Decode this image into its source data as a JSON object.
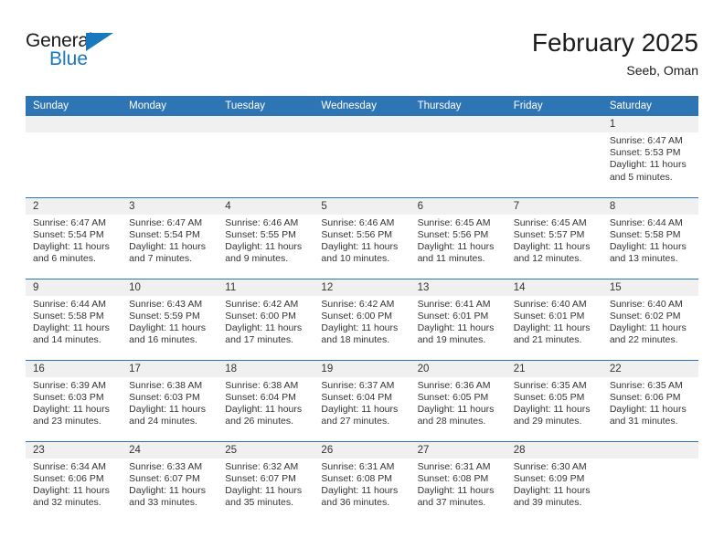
{
  "brand": {
    "name_part1": "General",
    "name_part2": "Blue",
    "logo_icon": "triangle-logo-icon"
  },
  "header": {
    "title": "February 2025",
    "subtitle": "Seeb, Oman"
  },
  "colors": {
    "header_blue": "#2e75b6",
    "brand_blue": "#1878be",
    "daynum_band": "#f0f0f0",
    "text": "#333333"
  },
  "weekday_headers": [
    "Sunday",
    "Monday",
    "Tuesday",
    "Wednesday",
    "Thursday",
    "Friday",
    "Saturday"
  ],
  "weeks": [
    [
      {
        "day": "",
        "empty": true
      },
      {
        "day": "",
        "empty": true
      },
      {
        "day": "",
        "empty": true
      },
      {
        "day": "",
        "empty": true
      },
      {
        "day": "",
        "empty": true
      },
      {
        "day": "",
        "empty": true
      },
      {
        "day": "1",
        "sunrise": "Sunrise: 6:47 AM",
        "sunset": "Sunset: 5:53 PM",
        "daylight": "Daylight: 11 hours and 5 minutes."
      }
    ],
    [
      {
        "day": "2",
        "sunrise": "Sunrise: 6:47 AM",
        "sunset": "Sunset: 5:54 PM",
        "daylight": "Daylight: 11 hours and 6 minutes."
      },
      {
        "day": "3",
        "sunrise": "Sunrise: 6:47 AM",
        "sunset": "Sunset: 5:54 PM",
        "daylight": "Daylight: 11 hours and 7 minutes."
      },
      {
        "day": "4",
        "sunrise": "Sunrise: 6:46 AM",
        "sunset": "Sunset: 5:55 PM",
        "daylight": "Daylight: 11 hours and 9 minutes."
      },
      {
        "day": "5",
        "sunrise": "Sunrise: 6:46 AM",
        "sunset": "Sunset: 5:56 PM",
        "daylight": "Daylight: 11 hours and 10 minutes."
      },
      {
        "day": "6",
        "sunrise": "Sunrise: 6:45 AM",
        "sunset": "Sunset: 5:56 PM",
        "daylight": "Daylight: 11 hours and 11 minutes."
      },
      {
        "day": "7",
        "sunrise": "Sunrise: 6:45 AM",
        "sunset": "Sunset: 5:57 PM",
        "daylight": "Daylight: 11 hours and 12 minutes."
      },
      {
        "day": "8",
        "sunrise": "Sunrise: 6:44 AM",
        "sunset": "Sunset: 5:58 PM",
        "daylight": "Daylight: 11 hours and 13 minutes."
      }
    ],
    [
      {
        "day": "9",
        "sunrise": "Sunrise: 6:44 AM",
        "sunset": "Sunset: 5:58 PM",
        "daylight": "Daylight: 11 hours and 14 minutes."
      },
      {
        "day": "10",
        "sunrise": "Sunrise: 6:43 AM",
        "sunset": "Sunset: 5:59 PM",
        "daylight": "Daylight: 11 hours and 16 minutes."
      },
      {
        "day": "11",
        "sunrise": "Sunrise: 6:42 AM",
        "sunset": "Sunset: 6:00 PM",
        "daylight": "Daylight: 11 hours and 17 minutes."
      },
      {
        "day": "12",
        "sunrise": "Sunrise: 6:42 AM",
        "sunset": "Sunset: 6:00 PM",
        "daylight": "Daylight: 11 hours and 18 minutes."
      },
      {
        "day": "13",
        "sunrise": "Sunrise: 6:41 AM",
        "sunset": "Sunset: 6:01 PM",
        "daylight": "Daylight: 11 hours and 19 minutes."
      },
      {
        "day": "14",
        "sunrise": "Sunrise: 6:40 AM",
        "sunset": "Sunset: 6:01 PM",
        "daylight": "Daylight: 11 hours and 21 minutes."
      },
      {
        "day": "15",
        "sunrise": "Sunrise: 6:40 AM",
        "sunset": "Sunset: 6:02 PM",
        "daylight": "Daylight: 11 hours and 22 minutes."
      }
    ],
    [
      {
        "day": "16",
        "sunrise": "Sunrise: 6:39 AM",
        "sunset": "Sunset: 6:03 PM",
        "daylight": "Daylight: 11 hours and 23 minutes."
      },
      {
        "day": "17",
        "sunrise": "Sunrise: 6:38 AM",
        "sunset": "Sunset: 6:03 PM",
        "daylight": "Daylight: 11 hours and 24 minutes."
      },
      {
        "day": "18",
        "sunrise": "Sunrise: 6:38 AM",
        "sunset": "Sunset: 6:04 PM",
        "daylight": "Daylight: 11 hours and 26 minutes."
      },
      {
        "day": "19",
        "sunrise": "Sunrise: 6:37 AM",
        "sunset": "Sunset: 6:04 PM",
        "daylight": "Daylight: 11 hours and 27 minutes."
      },
      {
        "day": "20",
        "sunrise": "Sunrise: 6:36 AM",
        "sunset": "Sunset: 6:05 PM",
        "daylight": "Daylight: 11 hours and 28 minutes."
      },
      {
        "day": "21",
        "sunrise": "Sunrise: 6:35 AM",
        "sunset": "Sunset: 6:05 PM",
        "daylight": "Daylight: 11 hours and 29 minutes."
      },
      {
        "day": "22",
        "sunrise": "Sunrise: 6:35 AM",
        "sunset": "Sunset: 6:06 PM",
        "daylight": "Daylight: 11 hours and 31 minutes."
      }
    ],
    [
      {
        "day": "23",
        "sunrise": "Sunrise: 6:34 AM",
        "sunset": "Sunset: 6:06 PM",
        "daylight": "Daylight: 11 hours and 32 minutes."
      },
      {
        "day": "24",
        "sunrise": "Sunrise: 6:33 AM",
        "sunset": "Sunset: 6:07 PM",
        "daylight": "Daylight: 11 hours and 33 minutes."
      },
      {
        "day": "25",
        "sunrise": "Sunrise: 6:32 AM",
        "sunset": "Sunset: 6:07 PM",
        "daylight": "Daylight: 11 hours and 35 minutes."
      },
      {
        "day": "26",
        "sunrise": "Sunrise: 6:31 AM",
        "sunset": "Sunset: 6:08 PM",
        "daylight": "Daylight: 11 hours and 36 minutes."
      },
      {
        "day": "27",
        "sunrise": "Sunrise: 6:31 AM",
        "sunset": "Sunset: 6:08 PM",
        "daylight": "Daylight: 11 hours and 37 minutes."
      },
      {
        "day": "28",
        "sunrise": "Sunrise: 6:30 AM",
        "sunset": "Sunset: 6:09 PM",
        "daylight": "Daylight: 11 hours and 39 minutes."
      },
      {
        "day": "",
        "empty": true
      }
    ]
  ]
}
